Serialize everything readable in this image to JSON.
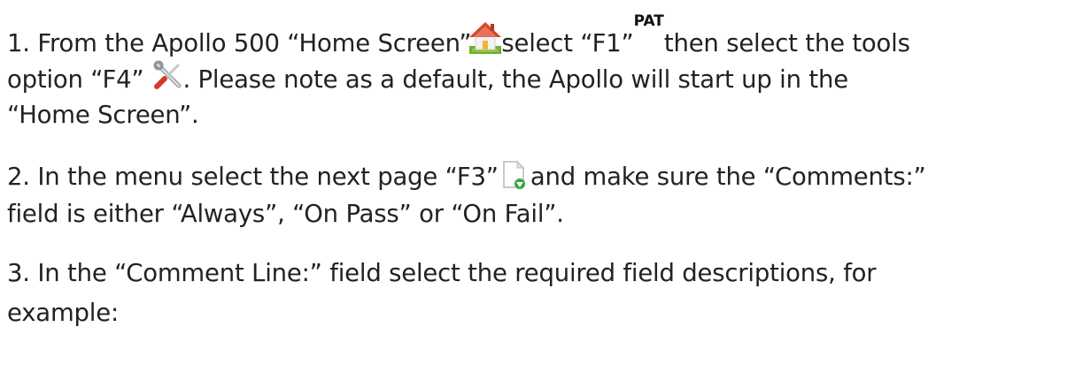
{
  "paragraphs": {
    "p1": {
      "l1": {
        "a": "1. From the Apollo 500 “Home Screen”",
        "b": "select “F1”",
        "pat": "PAT",
        "c": "then select the tools"
      },
      "l2": {
        "a": "option “F4”",
        "b": ". Please note as a default, the Apollo will start up in the"
      },
      "l3": "“Home Screen”."
    },
    "p2": {
      "l1": {
        "a": "2. In the menu select the next page “F3”",
        "b": "and make sure the “Comments:”"
      },
      "l2": "field is either “Always”, “On Pass” or “On Fail”."
    },
    "p3": {
      "l1": "3. In the “Comment Line:” field select the required field descriptions, for",
      "l2": "example:"
    }
  },
  "icons": {
    "home": "home-icon",
    "pat": "pat-icon",
    "tools": "tools-icon",
    "next_page": "next-page-icon"
  },
  "colors": {
    "text": "#222222",
    "roof": "#d9452b",
    "wall": "#f2f2f2",
    "grass": "#6fae2e",
    "page_arrow": "#3aa345"
  }
}
